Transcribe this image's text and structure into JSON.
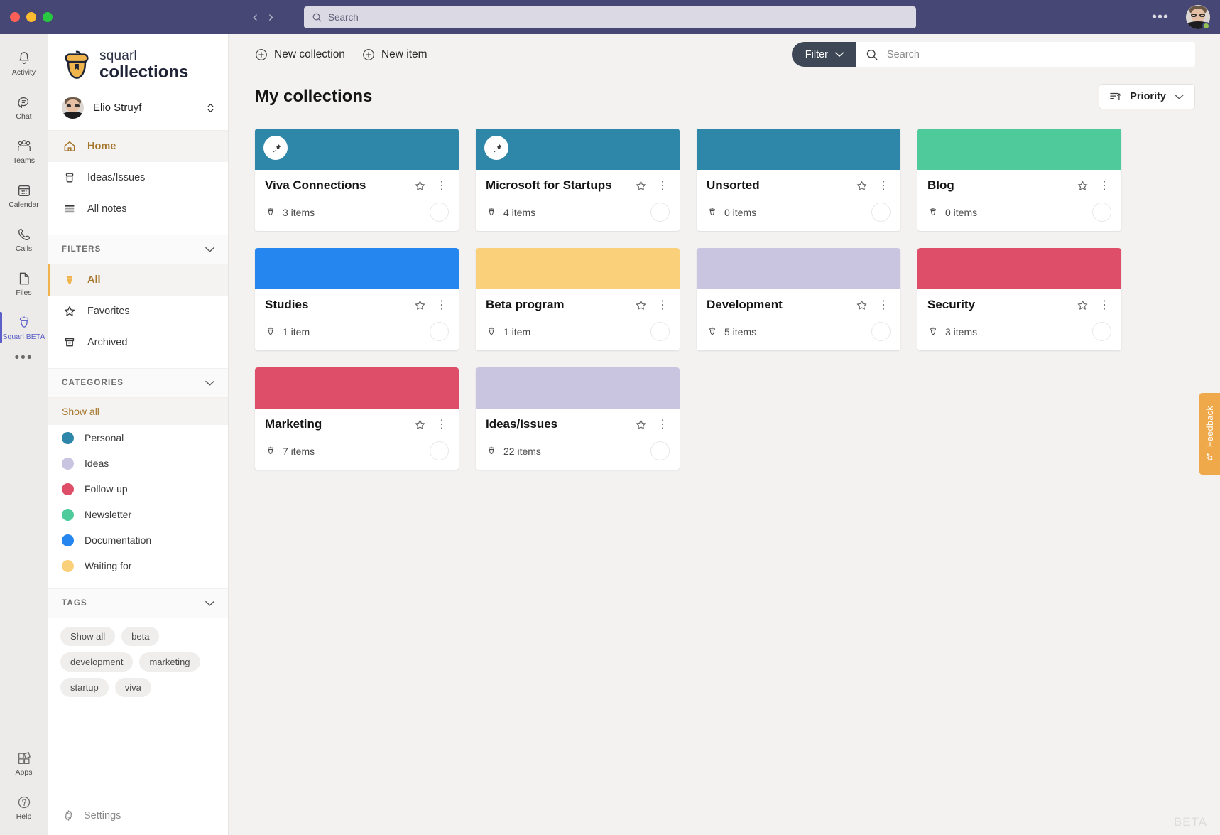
{
  "window": {
    "titlebar": {
      "back_icon": "chevron-left-icon",
      "forward_icon": "chevron-right-icon",
      "search_placeholder": "Search",
      "more_label": "•••",
      "accent": "#464775"
    }
  },
  "rail": {
    "items": [
      {
        "label": "Activity",
        "icon": "bell-icon",
        "active": false
      },
      {
        "label": "Chat",
        "icon": "chat-icon",
        "active": false
      },
      {
        "label": "Teams",
        "icon": "teams-icon",
        "active": false
      },
      {
        "label": "Calendar",
        "icon": "calendar-icon",
        "active": false
      },
      {
        "label": "Calls",
        "icon": "phone-icon",
        "active": false
      },
      {
        "label": "Files",
        "icon": "file-icon",
        "active": false
      },
      {
        "label": "Squarl BETA",
        "icon": "acorn-icon",
        "active": true
      }
    ],
    "more_label": "•••",
    "bottom": [
      {
        "label": "Apps",
        "icon": "apps-icon"
      },
      {
        "label": "Help",
        "icon": "help-icon"
      }
    ],
    "active_color": "#5B5FC7"
  },
  "sidebar": {
    "logo": {
      "line1": "squarl",
      "line2": "collections",
      "icon": "acorn-logo-icon"
    },
    "user": {
      "name": "Elio Struyf",
      "avatar": "user-avatar",
      "chevron": "chevron-updown-icon"
    },
    "nav": [
      {
        "label": "Home",
        "icon": "home-icon",
        "selected": true
      },
      {
        "label": "Ideas/Issues",
        "icon": "collection-icon",
        "selected": false
      },
      {
        "label": "All notes",
        "icon": "list-icon",
        "selected": false
      }
    ],
    "filters_section": {
      "title": "FILTERS",
      "chevron": "chevron-down-icon"
    },
    "filters": [
      {
        "label": "All",
        "icon": "acorn-filled-icon",
        "selected": true
      },
      {
        "label": "Favorites",
        "icon": "star-icon",
        "selected": false
      },
      {
        "label": "Archived",
        "icon": "archive-icon",
        "selected": false
      }
    ],
    "categories_section": {
      "title": "CATEGORIES",
      "chevron": "chevron-down-icon"
    },
    "categories_show_all": "Show all",
    "categories": [
      {
        "label": "Personal",
        "color": "#2E86A8"
      },
      {
        "label": "Ideas",
        "color": "#C9C5E0"
      },
      {
        "label": "Follow-up",
        "color": "#DE4E68"
      },
      {
        "label": "Newsletter",
        "color": "#4FCB9B"
      },
      {
        "label": "Documentation",
        "color": "#2686F0"
      },
      {
        "label": "Waiting for",
        "color": "#FBD07A"
      }
    ],
    "tags_section": {
      "title": "TAGS",
      "chevron": "chevron-down-icon"
    },
    "tags": [
      "Show all",
      "beta",
      "development",
      "marketing",
      "startup",
      "viva"
    ],
    "settings": {
      "label": "Settings",
      "icon": "gear-icon"
    }
  },
  "toolbar": {
    "new_collection": "New collection",
    "new_item": "New item",
    "plus_icon": "plus-circle-icon",
    "filter_label": "Filter",
    "filter_chevron": "chevron-down-icon",
    "search_placeholder": "Search",
    "search_icon": "search-icon",
    "filter_color": "#3E4755"
  },
  "content": {
    "page_title": "My collections",
    "sort": {
      "label": "Priority",
      "icon": "sort-ascending-icon",
      "chevron": "chevron-down-icon"
    },
    "collections": [
      {
        "title": "Viva Connections",
        "items": "3 items",
        "color": "#2E86A8",
        "pinned": true,
        "favorite": false
      },
      {
        "title": "Microsoft for Startups",
        "items": "4 items",
        "color": "#2E86A8",
        "pinned": true,
        "favorite": false
      },
      {
        "title": "Unsorted",
        "items": "0 items",
        "color": "#2E86A8",
        "pinned": false,
        "favorite": false
      },
      {
        "title": "Blog",
        "items": "0 items",
        "color": "#4FCB9B",
        "pinned": false,
        "favorite": false
      },
      {
        "title": "Studies",
        "items": "1 item",
        "color": "#2686F0",
        "pinned": false,
        "favorite": false
      },
      {
        "title": "Beta program",
        "items": "1 item",
        "color": "#FBD07A",
        "pinned": false,
        "favorite": false
      },
      {
        "title": "Development",
        "items": "5 items",
        "color": "#C9C5E0",
        "pinned": false,
        "favorite": false
      },
      {
        "title": "Security",
        "items": "3 items",
        "color": "#DE4E68",
        "pinned": false,
        "favorite": false
      },
      {
        "title": "Marketing",
        "items": "7 items",
        "color": "#DE4E68",
        "pinned": false,
        "favorite": false
      },
      {
        "title": "Ideas/Issues",
        "items": "22 items",
        "color": "#C9C5E0",
        "pinned": false,
        "favorite": false
      }
    ]
  },
  "feedback": {
    "label": "Feedback",
    "icon": "star-plus-icon",
    "color": "#EFA84A"
  },
  "beta_watermark": "BETA"
}
